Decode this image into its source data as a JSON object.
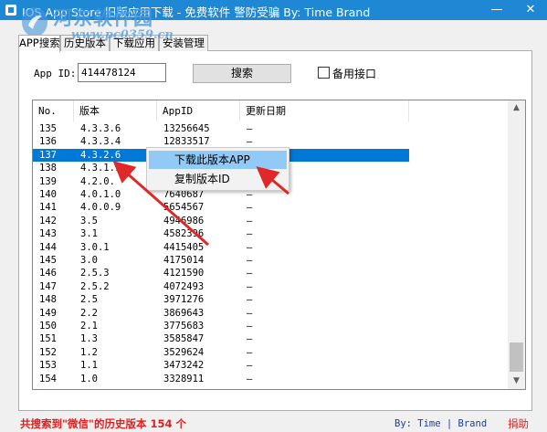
{
  "window": {
    "title": "IOS App Store 旧版应用下载 - 免费软件 警防受骗 By: Time Brand",
    "minimize_glyph": "—",
    "close_glyph": "✕",
    "titlebar_color": "#1e88d4"
  },
  "watermark": {
    "site_name": "河东软件园",
    "url": "www.pc0359.cn"
  },
  "tabs": [
    {
      "label": "APP搜索",
      "active": true
    },
    {
      "label": "历史版本",
      "active": false
    },
    {
      "label": "下载应用",
      "active": false
    },
    {
      "label": "安装管理",
      "active": false
    }
  ],
  "search": {
    "label": "App ID:",
    "value": "414478124",
    "button_label": "搜索",
    "backup_checkbox_label": "备用接口",
    "backup_checked": false
  },
  "table": {
    "columns": [
      "No.",
      "版本",
      "AppID",
      "更新日期"
    ],
    "selected_index": 2,
    "rows": [
      {
        "no": "135",
        "version": "4.3.3.6",
        "appid": "13256645",
        "date": "—"
      },
      {
        "no": "136",
        "version": "4.3.3.4",
        "appid": "12833517",
        "date": "—"
      },
      {
        "no": "137",
        "version": "4.3.2.6",
        "appid": "",
        "date": ""
      },
      {
        "no": "138",
        "version": "4.3.1.1",
        "appid": "",
        "date": ""
      },
      {
        "no": "139",
        "version": "4.2.0.",
        "appid": "",
        "date": ""
      },
      {
        "no": "140",
        "version": "4.0.1.0",
        "appid": "7640687",
        "date": "—"
      },
      {
        "no": "141",
        "version": "4.0.0.9",
        "appid": "5654567",
        "date": "—"
      },
      {
        "no": "142",
        "version": "3.5",
        "appid": "4946986",
        "date": "—"
      },
      {
        "no": "143",
        "version": "3.1",
        "appid": "4582396",
        "date": "—"
      },
      {
        "no": "144",
        "version": "3.0.1",
        "appid": "4415405",
        "date": "—"
      },
      {
        "no": "145",
        "version": "3.0",
        "appid": "4175014",
        "date": "—"
      },
      {
        "no": "146",
        "version": "2.5.3",
        "appid": "4121590",
        "date": "—"
      },
      {
        "no": "147",
        "version": "2.5.2",
        "appid": "4072493",
        "date": "—"
      },
      {
        "no": "148",
        "version": "2.5",
        "appid": "3971276",
        "date": "—"
      },
      {
        "no": "149",
        "version": "2.2",
        "appid": "3869643",
        "date": "—"
      },
      {
        "no": "150",
        "version": "2.1",
        "appid": "3775683",
        "date": "—"
      },
      {
        "no": "151",
        "version": "1.3",
        "appid": "3585847",
        "date": "—"
      },
      {
        "no": "152",
        "version": "1.2",
        "appid": "3529624",
        "date": "—"
      },
      {
        "no": "153",
        "version": "1.1",
        "appid": "3473242",
        "date": "—"
      },
      {
        "no": "154",
        "version": "1.0",
        "appid": "3328911",
        "date": "—"
      }
    ]
  },
  "scrollbar": {
    "up_glyph": "▲",
    "down_glyph": "▼"
  },
  "context_menu": {
    "items": [
      "下载此版本APP",
      "复制版本ID"
    ],
    "highlighted_index": 0
  },
  "status": {
    "result_text": "共搜索到\"微信\"的历史版本 154 个",
    "by_text": "By: Time | Brand",
    "donate_label": "捐助",
    "accent_color": "#e02020"
  }
}
